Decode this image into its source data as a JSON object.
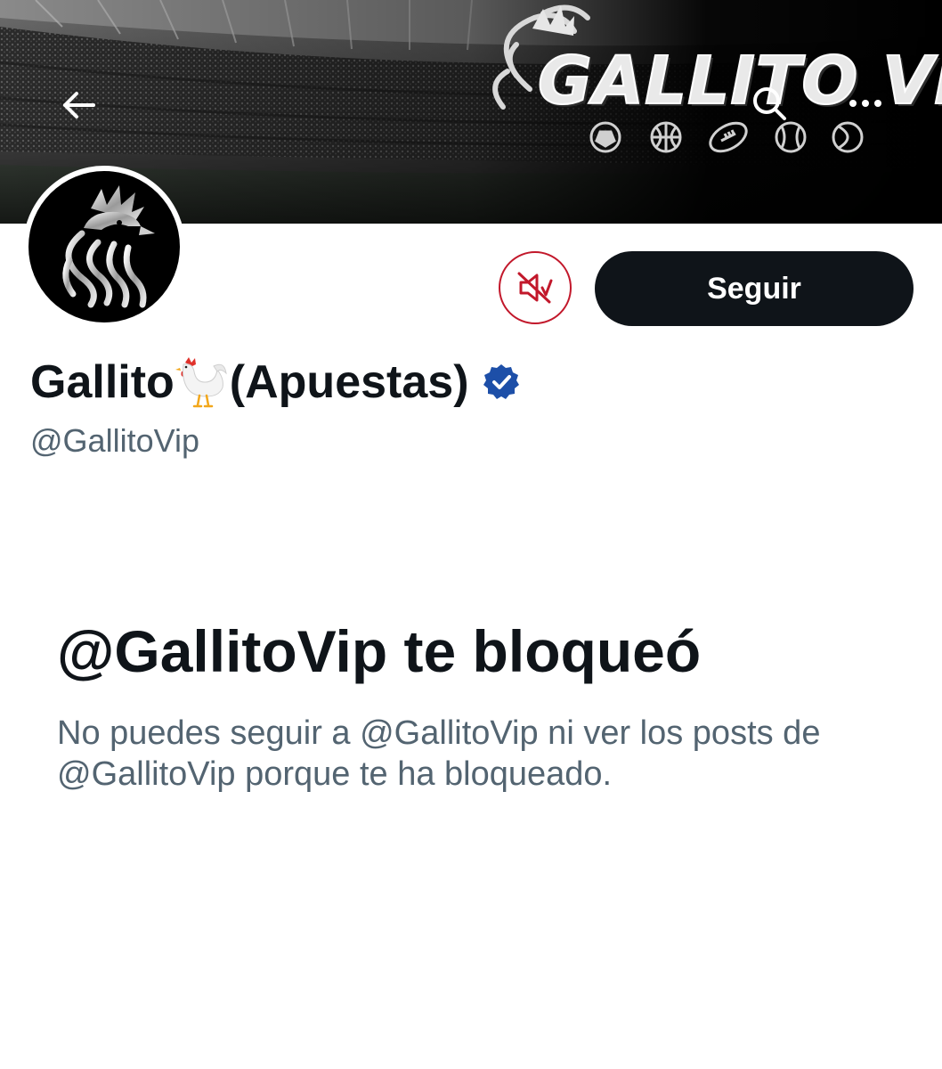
{
  "header": {
    "banner_brand": "GALLITO VIP",
    "icons": [
      "back-arrow-icon",
      "search-icon",
      "more-icon"
    ]
  },
  "profile": {
    "display_name_prefix": "Gallito",
    "display_name_emoji": "rooster-emoji",
    "display_name_suffix": "(Apuestas)",
    "verified": true,
    "handle": "@GallitoVip"
  },
  "actions": {
    "mute_icon": "muted-speaker-icon",
    "follow_label": "Seguir"
  },
  "blocked": {
    "title": "@GallitoVip te bloqueó",
    "description": "No puedes seguir a @GallitoVip ni ver los posts de @GallitoVip porque te ha bloqueado."
  },
  "colors": {
    "text_primary": "#0f1419",
    "text_secondary": "#536471",
    "follow_button_bg": "#0f1419",
    "mute_button_border": "#c2182b",
    "verified_blue": "#1d4fa8"
  }
}
